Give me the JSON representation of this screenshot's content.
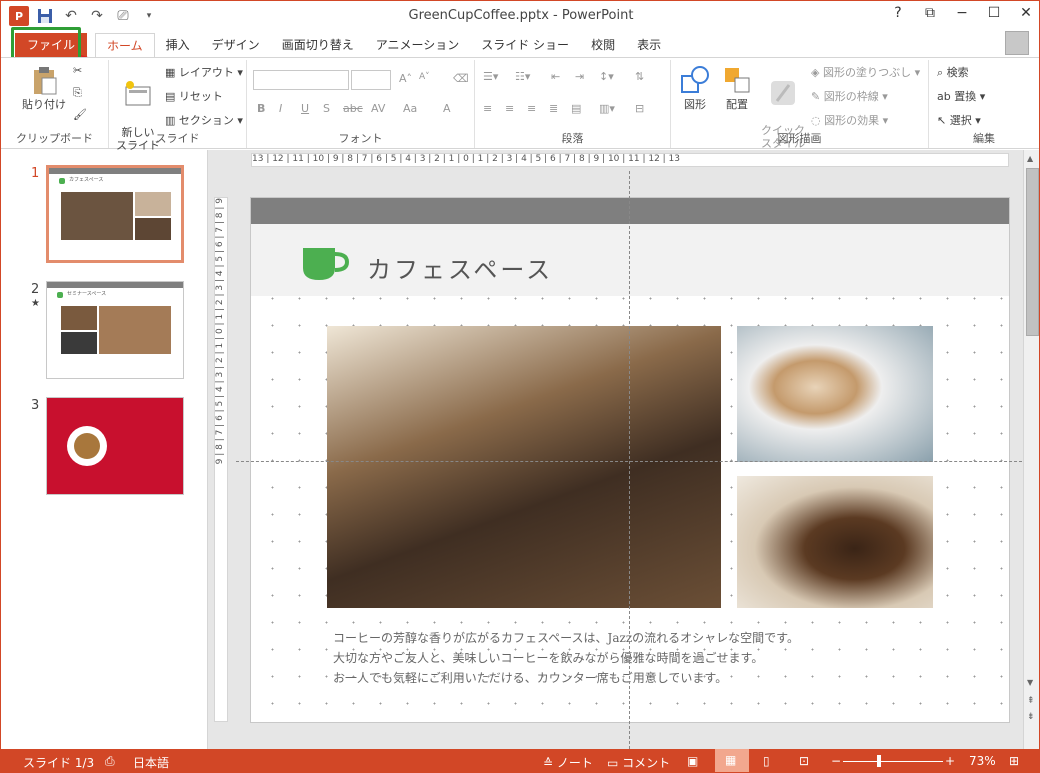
{
  "window": {
    "title": "GreenCupCoffee.pptx - PowerPoint",
    "app_logo": "P",
    "controls": [
      "?",
      "⧉",
      "−",
      "☐",
      "✕"
    ]
  },
  "qat": {
    "save_icon": "save-icon",
    "undo_icon": "undo-icon",
    "redo_icon": "redo-icon",
    "present_icon": "present-icon"
  },
  "tabs": [
    "ファイル",
    "ホーム",
    "挿入",
    "デザイン",
    "画面切り替え",
    "アニメーション",
    "スライド ショー",
    "校閲",
    "表示"
  ],
  "ribbon": {
    "clipboard": {
      "paste": "貼り付け",
      "label": "クリップボード"
    },
    "slides": {
      "new_slide": "新しい\nスライド",
      "layout": "レイアウト",
      "reset": "リセット",
      "section": "セクション",
      "label": "スライド"
    },
    "font": {
      "label": "フォント",
      "bold": "B",
      "italic": "I",
      "underline": "U",
      "shadow": "S",
      "strike": "abc",
      "spacing": "AV",
      "case": "Aa",
      "color": "A",
      "grow": "A",
      "shrink": "A"
    },
    "paragraph": {
      "label": "段落"
    },
    "drawing": {
      "shape": "図形",
      "arrange": "配置",
      "quick_style": "クイック\nスタイル",
      "fill": "図形の塗りつぶし",
      "outline": "図形の枠線",
      "effect": "図形の効果",
      "label": "図形描画"
    },
    "editing": {
      "find": "検索",
      "replace": "置換",
      "select": "選択",
      "label": "編集"
    }
  },
  "thumbnails": [
    {
      "num": "1",
      "title": "カフェスペース",
      "star": ""
    },
    {
      "num": "2",
      "title": "セミナースペース",
      "star": "★"
    },
    {
      "num": "3",
      "title": "",
      "star": ""
    }
  ],
  "ruler": {
    "h": "13 | 12 | 11 | 10 | 9 | 8 | 7 | 6 | 5 | 4 | 3 | 2 | 1 | 0 | 1 | 2 | 3 | 4 | 5 | 6 | 7 | 8 | 9 | 10 | 11 | 12 | 13"
  },
  "slide": {
    "title": "カフェスペース",
    "body": [
      "コーヒーの芳醇な香りが広がるカフェスペースは、Jazzの流れるオシャレな空間です。",
      "大切な方やご友人と、美味しいコーヒーを飲みながら優雅な時間を過ごせます。",
      "お一人でも気軽にご利用いただける、カウンター席もご用意しています。"
    ],
    "accent": "#4caf50",
    "header_bar": "#7f7f7f"
  },
  "status": {
    "slide": "スライド 1/3",
    "lang": "日本語",
    "notes": "ノート",
    "comments": "コメント",
    "zoom": "73%",
    "color": "#d24726"
  }
}
